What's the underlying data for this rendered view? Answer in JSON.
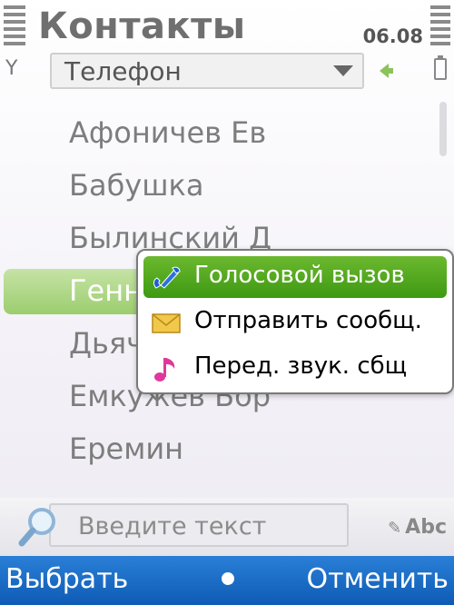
{
  "header": {
    "title": "Контакты",
    "time": "06.08"
  },
  "filter": {
    "selected": "Телефон"
  },
  "contacts": [
    {
      "name": "Афоничев Ев"
    },
    {
      "name": "Бабушка"
    },
    {
      "name": "Былинский Д"
    },
    {
      "name": "Генн"
    },
    {
      "name": "Дьяч"
    },
    {
      "name": "Емкужев Бор"
    },
    {
      "name": "Еремин"
    }
  ],
  "context_menu": {
    "items": [
      {
        "label": "Голосовой вызов",
        "icon": "phone-handset-icon"
      },
      {
        "label": "Отправить сообщ.",
        "icon": "envelope-icon"
      },
      {
        "label": "Перед. звук. сбщ",
        "icon": "music-note-icon"
      }
    ]
  },
  "search": {
    "placeholder": "Введите текст",
    "input_mode": "Abc"
  },
  "softkeys": {
    "left": "Выбрать",
    "right": "Отменить"
  },
  "colors": {
    "accent_green": "#4aa61b",
    "softkey_blue": "#1a6cc6",
    "highlight_green": "#a8d57c"
  }
}
